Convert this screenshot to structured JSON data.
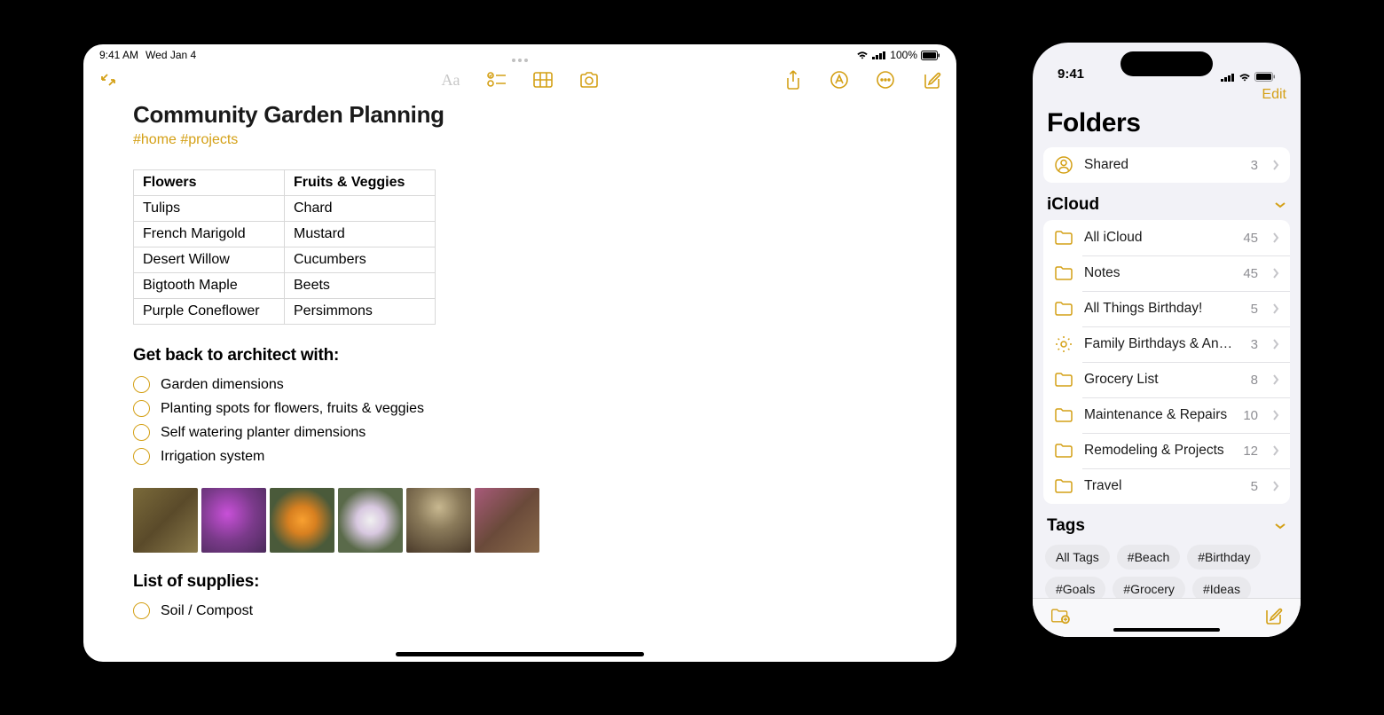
{
  "ipad": {
    "status": {
      "time": "9:41 AM",
      "date": "Wed Jan 4",
      "battery": "100%"
    },
    "note": {
      "title": "Community Garden Planning",
      "tags": "#home #projects",
      "table": {
        "headers": [
          "Flowers",
          "Fruits & Veggies"
        ],
        "rows": [
          [
            "Tulips",
            "Chard"
          ],
          [
            "French Marigold",
            "Mustard"
          ],
          [
            "Desert Willow",
            "Cucumbers"
          ],
          [
            "Bigtooth Maple",
            "Beets"
          ],
          [
            "Purple Coneflower",
            "Persimmons"
          ]
        ]
      },
      "heading1": "Get back to architect with:",
      "checklist1": [
        "Garden dimensions",
        "Planting spots for flowers, fruits & veggies",
        "Self watering planter dimensions",
        "Irrigation system"
      ],
      "heading2": "List of supplies:",
      "checklist2": [
        "Soil / Compost"
      ]
    }
  },
  "iphone": {
    "status": {
      "time": "9:41"
    },
    "edit_label": "Edit",
    "title": "Folders",
    "shared": {
      "label": "Shared",
      "count": "3"
    },
    "icloud_header": "iCloud",
    "icloud": [
      {
        "icon": "folder",
        "label": "All iCloud",
        "count": "45"
      },
      {
        "icon": "folder",
        "label": "Notes",
        "count": "45"
      },
      {
        "icon": "folder",
        "label": "All Things Birthday!",
        "count": "5"
      },
      {
        "icon": "gear",
        "label": "Family Birthdays & Anniversaries",
        "count": "3"
      },
      {
        "icon": "folder",
        "label": "Grocery List",
        "count": "8"
      },
      {
        "icon": "folder",
        "label": "Maintenance & Repairs",
        "count": "10"
      },
      {
        "icon": "folder",
        "label": "Remodeling & Projects",
        "count": "12"
      },
      {
        "icon": "folder",
        "label": "Travel",
        "count": "5"
      }
    ],
    "tags_header": "Tags",
    "tags": [
      "All Tags",
      "#Beach",
      "#Birthday",
      "#Goals",
      "#Grocery",
      "#Ideas"
    ]
  }
}
